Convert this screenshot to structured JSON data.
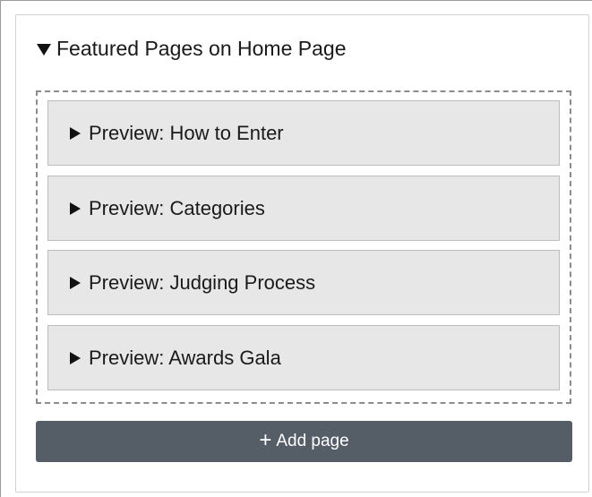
{
  "section": {
    "title": "Featured Pages on Home Page",
    "expanded": true,
    "toggle_icon": "triangle-down-icon"
  },
  "previews": [
    {
      "label": "Preview: How to Enter",
      "icon": "triangle-right-icon"
    },
    {
      "label": "Preview: Categories",
      "icon": "triangle-right-icon"
    },
    {
      "label": "Preview: Judging Process",
      "icon": "triangle-right-icon"
    },
    {
      "label": "Preview: Awards Gala",
      "icon": "triangle-right-icon"
    }
  ],
  "add_button": {
    "icon": "plus-icon",
    "icon_glyph": "+",
    "label": "Add page"
  },
  "colors": {
    "button_bg": "#555d66",
    "item_bg": "#e7e7e7"
  }
}
